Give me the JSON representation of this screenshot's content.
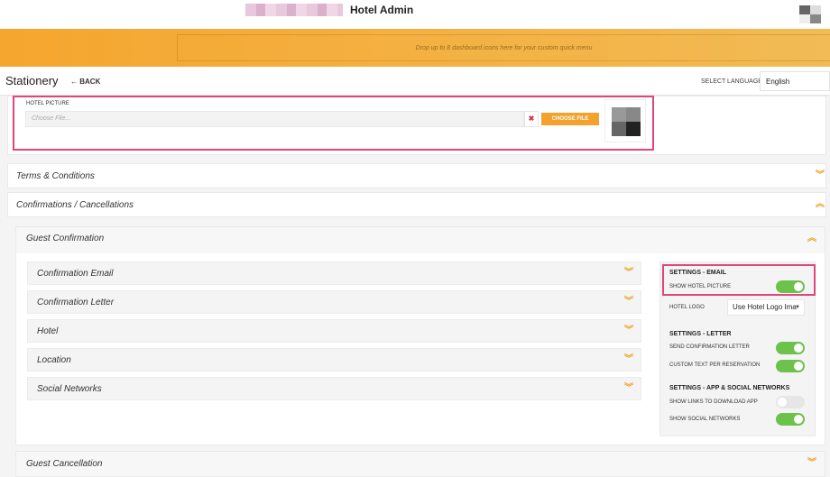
{
  "app": {
    "title": "Hotel Admin"
  },
  "quickmenu": {
    "placeholder": "Drop up to 8 dashboard icons here for your custom quick menu"
  },
  "page": {
    "title": "Stationery",
    "back_label": "BACK"
  },
  "language": {
    "label": "SELECT LANGUAGE",
    "selected": "English"
  },
  "hotel_picture": {
    "label": "HOTEL PICTURE",
    "placeholder": "Choose File...",
    "clear_symbol": "✖",
    "choose_label": "CHOOSE FILE"
  },
  "sections": {
    "terms": "Terms & Conditions",
    "confirmations": "Confirmations / Cancellations"
  },
  "guest_confirmation": {
    "title": "Guest Confirmation",
    "items": [
      {
        "label": "Confirmation Email"
      },
      {
        "label": "Confirmation Letter"
      },
      {
        "label": "Hotel"
      },
      {
        "label": "Location"
      },
      {
        "label": "Social Networks"
      }
    ]
  },
  "settings": {
    "email_head": "SETTINGS - EMAIL",
    "show_hotel_picture": {
      "label": "SHOW HOTEL PICTURE",
      "on": true
    },
    "hotel_logo": {
      "label": "HOTEL LOGO",
      "value": "Use Hotel Logo Ima"
    },
    "letter_head": "SETTINGS - LETTER",
    "send_confirmation_letter": {
      "label": "SEND CONFIRMATION LETTER",
      "on": true
    },
    "custom_text": {
      "label": "CUSTOM TEXT PER RESERVATION",
      "on": true
    },
    "app_head": "SETTINGS - APP & SOCIAL NETWORKS",
    "show_links": {
      "label": "SHOW LINKS TO DOWNLOAD APP",
      "on": false
    },
    "show_social": {
      "label": "SHOW SOCIAL NETWORKS",
      "on": true
    }
  },
  "guest_cancellation": {
    "title": "Guest Cancellation"
  },
  "colors": {
    "accent": "#f4a22e",
    "highlight": "#e0457b",
    "toggle_on": "#6cc24a"
  },
  "icons": {
    "expand": "chevron-double-down-icon",
    "collapse": "chevron-double-up-icon"
  }
}
